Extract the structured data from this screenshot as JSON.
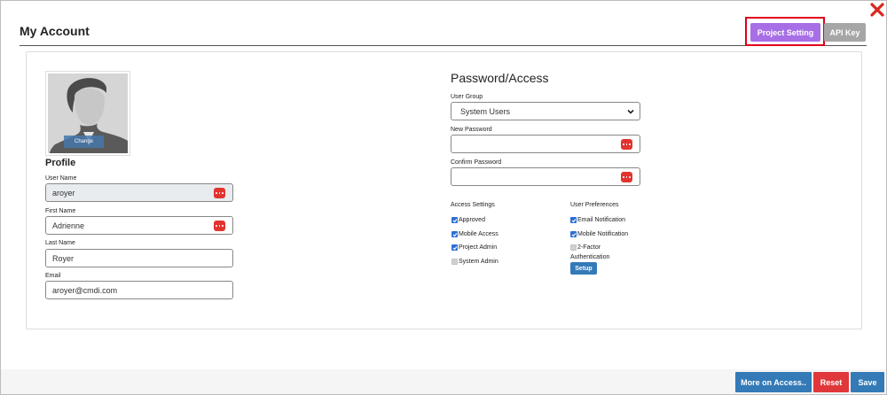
{
  "header": {
    "title": "My Account",
    "project_setting_label": "Project Setting",
    "api_key_label": "API Key"
  },
  "profile": {
    "heading": "Profile",
    "change_label": "Change",
    "user_name": {
      "label": "User Name",
      "value": "aroyer"
    },
    "first_name": {
      "label": "First Name",
      "value": "Adrienne"
    },
    "last_name": {
      "label": "Last Name",
      "value": "Royer"
    },
    "email": {
      "label": "Email",
      "value": "aroyer@cmdi.com"
    }
  },
  "password_access": {
    "heading": "Password/Access",
    "user_group": {
      "label": "User Group",
      "selected": "System Users"
    },
    "new_password": {
      "label": "New Password",
      "value": ""
    },
    "confirm_password": {
      "label": "Confirm Password",
      "value": ""
    }
  },
  "access_settings": {
    "heading": "Access Settings",
    "items": [
      {
        "label": "Approved",
        "checked": true
      },
      {
        "label": "Mobile Access",
        "checked": true
      },
      {
        "label": "Project Admin",
        "checked": true
      },
      {
        "label": "System Admin",
        "checked": false
      }
    ]
  },
  "user_preferences": {
    "heading": "User Preferences",
    "items": [
      {
        "label": "Email Notification",
        "checked": true
      },
      {
        "label": "Mobile Notification",
        "checked": true
      },
      {
        "label": "2-Factor",
        "checked": false
      }
    ],
    "two_factor_suffix": "Authentication",
    "setup_label": "Setup"
  },
  "footer": {
    "more_label": "More on Access..",
    "reset_label": "Reset",
    "save_label": "Save"
  },
  "colors": {
    "accent_purple": "#a86ee6",
    "primary_blue": "#337ab7",
    "danger_red": "#e0383a",
    "highlight_red": "#e0001b"
  }
}
